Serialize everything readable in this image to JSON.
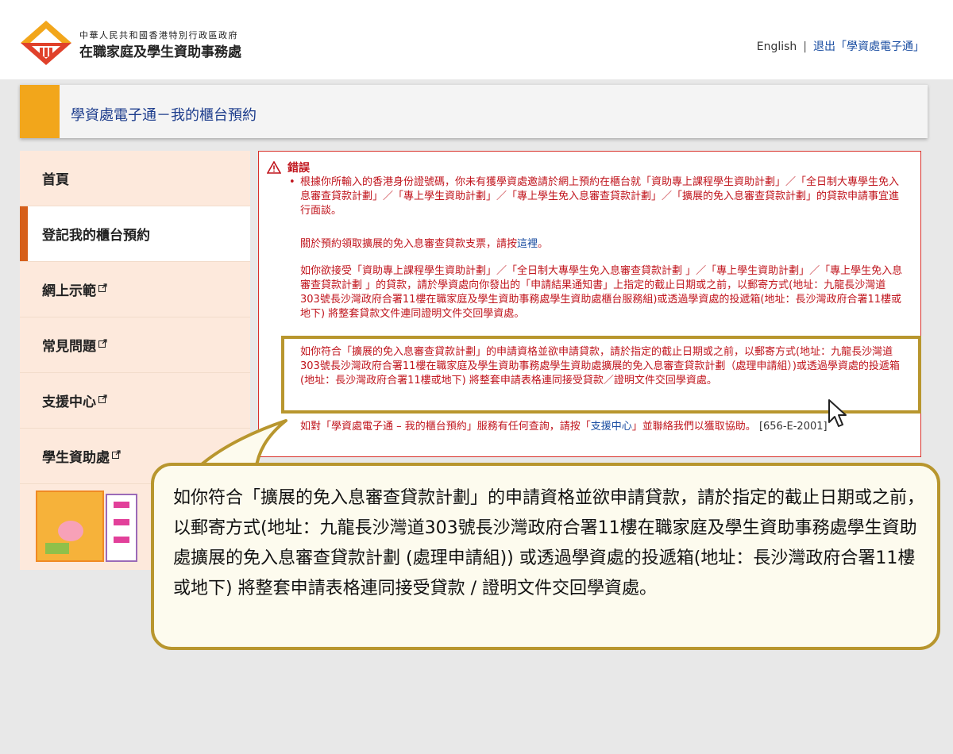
{
  "header": {
    "org_subtitle": "中華人民共和國香港特別行政區政府",
    "org_name": "在職家庭及學生資助事務處",
    "lang_link": "English",
    "separator": "|",
    "logout_link": "退出「學資處電子通」",
    "logo_colors": [
      "#f2a61b",
      "#e0412b"
    ]
  },
  "title_bar": {
    "title": "學資處電子通－我的櫃台預約",
    "accent_color": "#f2a61b"
  },
  "sidebar": {
    "items": [
      {
        "label": "首頁",
        "external": false,
        "active": false
      },
      {
        "label": "登記我的櫃台預約",
        "external": false,
        "active": true
      },
      {
        "label": "網上示範",
        "external": true,
        "active": false
      },
      {
        "label": "常見問題",
        "external": true,
        "active": false
      },
      {
        "label": "支援中心",
        "external": true,
        "active": false
      },
      {
        "label": "學生資助處",
        "external": true,
        "active": false
      }
    ]
  },
  "error_box": {
    "heading": "錯誤",
    "para1": "根據你所輸入的香港身份證號碼，你未有獲學資處邀請於網上預約在櫃台就「資助專上課程學生資助計劃」／「全日制大專學生免入息審查貸款計劃」／「專上學生資助計劃」／「專上學生免入息審查貸款計劃」／「擴展的免入息審查貸款計劃」的貸款申請事宜進行面談。",
    "para2_prefix": "關於預約領取擴展的免入息審查貸款支票，請按",
    "para2_link": "這裡",
    "para2_suffix": "。",
    "para3": "如你欲接受「資助專上課程學生資助計劃」／「全日制大專學生免入息審查貸款計劃 」／「專上學生資助計劃」／「專上學生免入息審查貸款計劃 」的貸款，請於學資處向你發出的「申請結果通知書」上指定的截止日期或之前，以郵寄方式(地址：九龍長沙灣道303號長沙灣政府合署11樓在職家庭及學生資助事務處學生資助處櫃台服務組)或透過學資處的投遞箱(地址：長沙灣政府合署11樓或地下) 將整套貸款文件連同證明文件交回學資處。",
    "para4": "如你符合「擴展的免入息審查貸款計劃」的申請資格並欲申請貸款，請於指定的截止日期或之前，以郵寄方式(地址：九龍長沙灣道303號長沙灣政府合署11樓在職家庭及學生資助事務處學生資助處擴展的免入息審查貸款計劃（處理申請組）)或透過學資處的投遞箱(地址：長沙灣政府合署11樓或地下) 將整套申請表格連同接受貸款／證明文件交回學資處。",
    "para5_prefix": "如對「學資處電子通 – 我的櫃台預約」服務有任何查詢，請按「",
    "para5_link": "支援中心",
    "para5_suffix": "」並聯絡我們以獲取協助。",
    "error_code": "[656-E-2001]"
  },
  "callout": {
    "text": "如你符合「擴展的免入息審查貸款計劃」的申請資格並欲申請貸款，請於指定的截止日期或之前，以郵寄方式(地址：九龍長沙灣道303號長沙灣政府合署11樓在職家庭及學生資助事務處學生資助處擴展的免入息審查貸款計劃 (處理申請組)) 或透過學資處的投遞箱(地址：長沙灣政府合署11樓或地下) 將整套申請表格連同接受貸款 / 證明文件交回學資處。",
    "border_color": "#b8962e"
  },
  "colors": {
    "error_red": "#c0141c",
    "link_blue": "#1a4da1",
    "sidebar_bg": "#fde9dc",
    "active_marker": "#d65f1a"
  }
}
